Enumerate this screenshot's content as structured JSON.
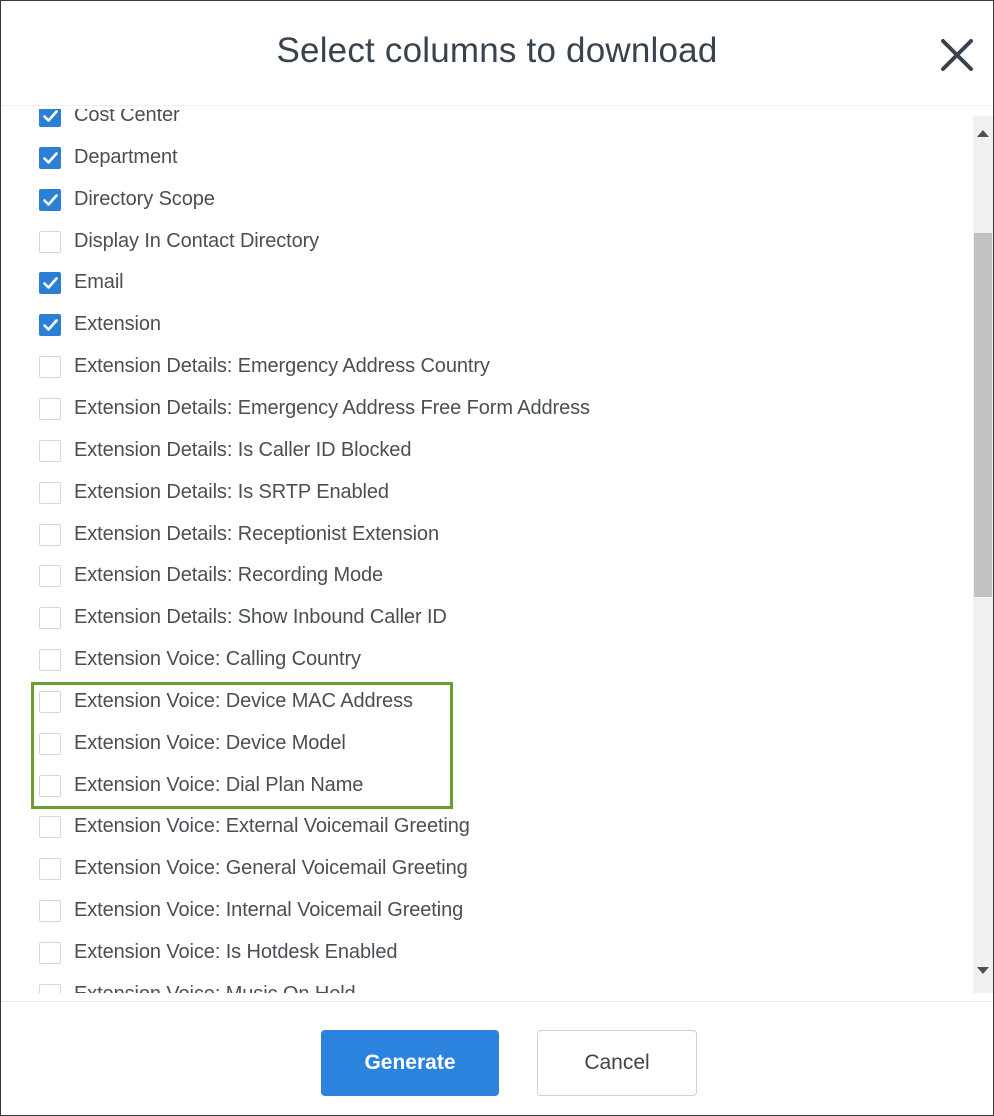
{
  "dialog": {
    "title": "Select columns to download",
    "close_icon": "close-icon"
  },
  "columns": [
    {
      "label": "Cost Center",
      "checked": true
    },
    {
      "label": "Department",
      "checked": true
    },
    {
      "label": "Directory Scope",
      "checked": true
    },
    {
      "label": "Display In Contact Directory",
      "checked": false
    },
    {
      "label": "Email",
      "checked": true
    },
    {
      "label": "Extension",
      "checked": true
    },
    {
      "label": "Extension Details: Emergency Address Country",
      "checked": false
    },
    {
      "label": "Extension Details: Emergency Address Free Form Address",
      "checked": false
    },
    {
      "label": "Extension Details: Is Caller ID Blocked",
      "checked": false
    },
    {
      "label": "Extension Details: Is SRTP Enabled",
      "checked": false
    },
    {
      "label": "Extension Details: Receptionist Extension",
      "checked": false
    },
    {
      "label": "Extension Details: Recording Mode",
      "checked": false
    },
    {
      "label": "Extension Details: Show Inbound Caller ID",
      "checked": false
    },
    {
      "label": "Extension Voice: Calling Country",
      "checked": false
    },
    {
      "label": "Extension Voice: Device MAC Address",
      "checked": false
    },
    {
      "label": "Extension Voice: Device Model",
      "checked": false
    },
    {
      "label": "Extension Voice: Dial Plan Name",
      "checked": false
    },
    {
      "label": "Extension Voice: External Voicemail Greeting",
      "checked": false
    },
    {
      "label": "Extension Voice: General Voicemail Greeting",
      "checked": false
    },
    {
      "label": "Extension Voice: Internal Voicemail Greeting",
      "checked": false
    },
    {
      "label": "Extension Voice: Is Hotdesk Enabled",
      "checked": false
    },
    {
      "label": "Extension Voice: Music On Hold",
      "checked": false
    }
  ],
  "footer": {
    "generate_label": "Generate",
    "cancel_label": "Cancel"
  },
  "colors": {
    "accent": "#2b83dd",
    "checkbox_checked": "#2b80d6",
    "highlight_border": "#6a9e2e"
  }
}
